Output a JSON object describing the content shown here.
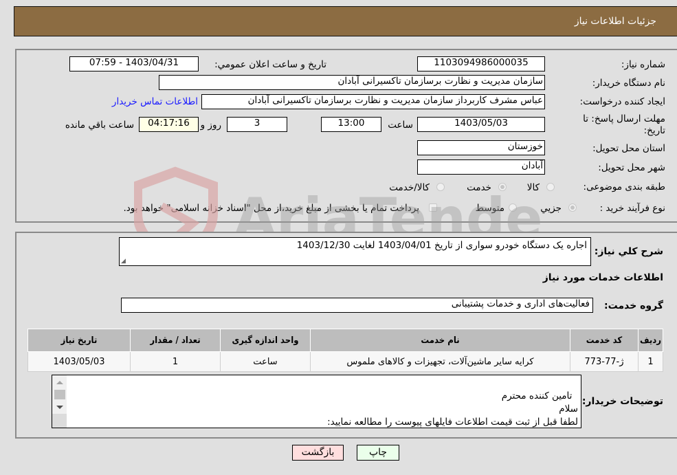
{
  "header": {
    "title": "جزئیات اطلاعات نیاز"
  },
  "form": {
    "need_number": {
      "label": "شماره نیاز:",
      "value": "1103094986000035"
    },
    "announce_datetime": {
      "label": "تاریخ و ساعت اعلان عمومي:",
      "value": "1403/04/31 - 07:59"
    },
    "buyer_org": {
      "label": "نام دستگاه خریدار:",
      "value": "سازمان مدیریت و نظارت برسازمان تاکسیرانی آبادان"
    },
    "requester": {
      "label": "ایجاد کننده درخواست:",
      "value": "عباس مشرف کاربرداز سازمان مدیریت و نظارت برسازمان تاکسیرانی آبادان"
    },
    "buyer_contact_link": "اطلاعات تماس خریدار",
    "deadline": {
      "label": "مهلت ارسال پاسخ: تا تاریخ:",
      "date": "1403/05/03",
      "time_label": "ساعت",
      "time": "13:00",
      "days": "3",
      "days_label": "روز و",
      "remaining": "04:17:16",
      "remaining_label": "ساعت باقي مانده"
    },
    "province": {
      "label": "استان محل تحویل:",
      "value": "خوزستان"
    },
    "city": {
      "label": "شهر محل تحویل:",
      "value": "آبادان"
    },
    "category": {
      "label": "طبقه بندی موضوعی:",
      "options": [
        "کالا",
        "خدمت",
        "کالا/خدمت"
      ],
      "selected": "خدمت"
    },
    "purchase_type": {
      "label": "نوع فرآیند خرید :",
      "options": [
        "جزیي",
        "متوسط"
      ],
      "selected": "جزیي",
      "treasury_note": "پرداخت تمام یا بخشی از مبلغ خرید،از محل \"اسناد خزانه اسلامی\" خواهد بود."
    }
  },
  "details": {
    "description_label": "شرح کلي نیاز:",
    "description": "اجاره یک دستگاه خودرو سواری از تاریخ 1403/04/01 لغایت 1403/12/30",
    "services_title": "اطلاعات خدمات مورد نیاز",
    "service_group_label": "گروه خدمت:",
    "service_group": "فعالیت‌های اداری و خدمات پشتیبانی",
    "table": {
      "headers": [
        "ردیف",
        "کد خدمت",
        "نام خدمت",
        "واحد اندازه گیری",
        "تعداد / مقدار",
        "تاریخ نیاز"
      ],
      "rows": [
        [
          "1",
          "ژ-77-773",
          "کرایه سایر ماشین‌آلات، تجهیزات و کالاهای ملموس",
          "ساعت",
          "1",
          "1403/05/03"
        ]
      ]
    },
    "buyer_notes_label": "توضیحات خریدار:",
    "buyer_notes": "تامین کننده محترم\nسلام\nلطفا قبل از ثبت قیمت اطلاعات فایلهای پیوست را مطالعه نمایید:\n-        - فایلهای پیوست حتما مهر و امضا و بارگزاری شود"
  },
  "buttons": {
    "print": "چاپ",
    "back": "بازگشت"
  },
  "watermark": "AriaTender.neT",
  "colors": {
    "header_bg": "#8c6c42",
    "link": "#1a1aff",
    "back_btn": "#ffdede",
    "print_btn": "#eaffea"
  }
}
